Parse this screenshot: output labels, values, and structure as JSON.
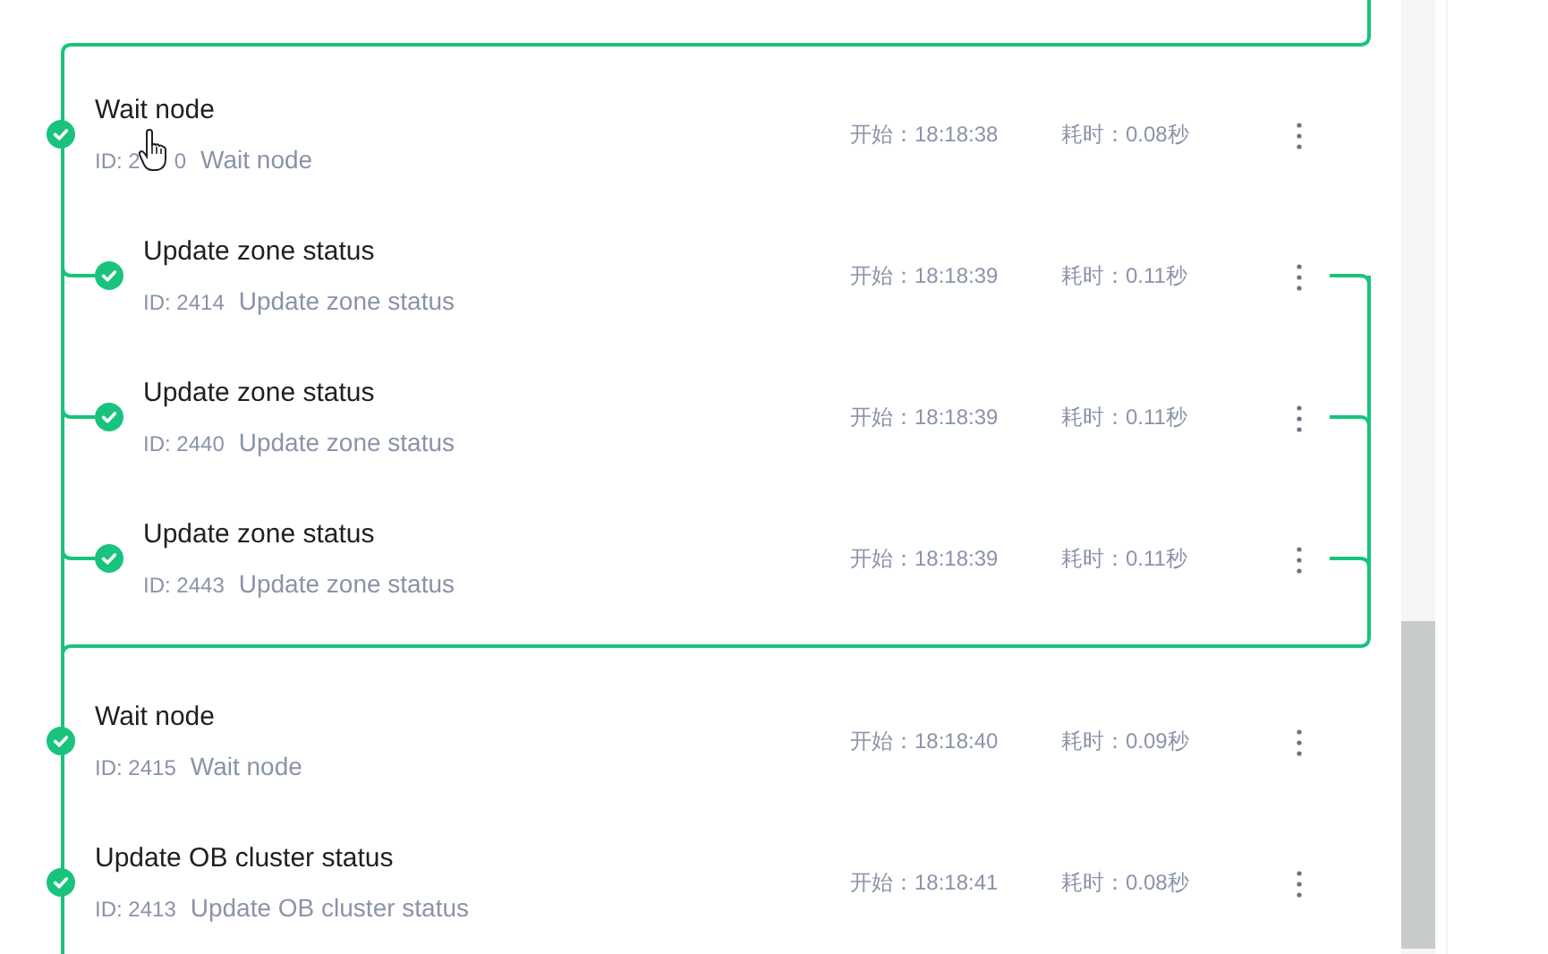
{
  "steps": [
    {
      "title": "Wait node",
      "id": "ID: 2",
      "id_tail": "0",
      "name": "Wait node",
      "done": true,
      "start": "开始：18:18:38",
      "duration": "耗时：0.08秒",
      "cursor": true,
      "children": [
        {
          "title": "Update zone status",
          "id": "ID: 2414",
          "name": "Update zone status",
          "done": true,
          "start": "开始：18:18:39",
          "duration": "耗时：0.11秒"
        },
        {
          "title": "Update zone status",
          "id": "ID: 2440",
          "name": "Update zone status",
          "done": true,
          "start": "开始：18:18:39",
          "duration": "耗时：0.11秒"
        },
        {
          "title": "Update zone status",
          "id": "ID: 2443",
          "name": "Update zone status",
          "done": true,
          "start": "开始：18:18:39",
          "duration": "耗时：0.11秒"
        }
      ]
    },
    {
      "title": "Wait node",
      "id": "ID: 2415",
      "name": "Wait node",
      "done": true,
      "start": "开始：18:18:40",
      "duration": "耗时：0.09秒"
    },
    {
      "title": "Update OB cluster status",
      "id": "ID: 2413",
      "name": "Update OB cluster status",
      "done": true,
      "start": "开始：18:18:41",
      "duration": "耗时：0.08秒"
    }
  ]
}
